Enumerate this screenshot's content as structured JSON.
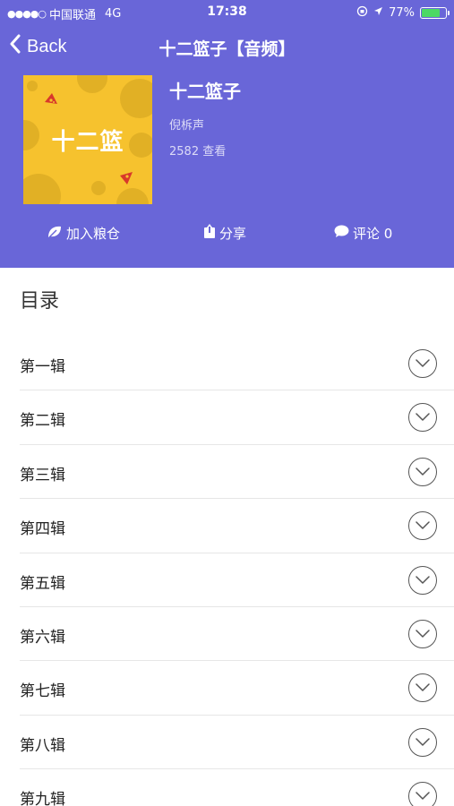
{
  "status_bar": {
    "signal": "●●●●○",
    "carrier": "中国联通",
    "network": "4G",
    "time": "17:38",
    "battery": "77%",
    "battery_level": 0.77,
    "battery_color": "#4cd964"
  },
  "nav": {
    "back_label": "Back",
    "title": "十二篮子【音频】"
  },
  "album": {
    "cover_text": "十二篮",
    "title": "十二篮子",
    "author": "倪柝声",
    "views": "2582 查看"
  },
  "actions": {
    "add": {
      "icon": "leaf-icon",
      "label": "加入粮仓"
    },
    "share": {
      "icon": "share-icon",
      "label": "分享"
    },
    "comment": {
      "icon": "comment-bubble-icon",
      "label": "评论 0"
    }
  },
  "catalog": {
    "title": "目录",
    "items": [
      {
        "label": "第一辑"
      },
      {
        "label": "第二辑"
      },
      {
        "label": "第三辑"
      },
      {
        "label": "第四辑"
      },
      {
        "label": "第五辑"
      },
      {
        "label": "第六辑"
      },
      {
        "label": "第七辑"
      },
      {
        "label": "第八辑"
      },
      {
        "label": "第九辑"
      }
    ]
  },
  "colors": {
    "header_bg": "#6966d8",
    "cover_bg": "#f6c22e"
  }
}
